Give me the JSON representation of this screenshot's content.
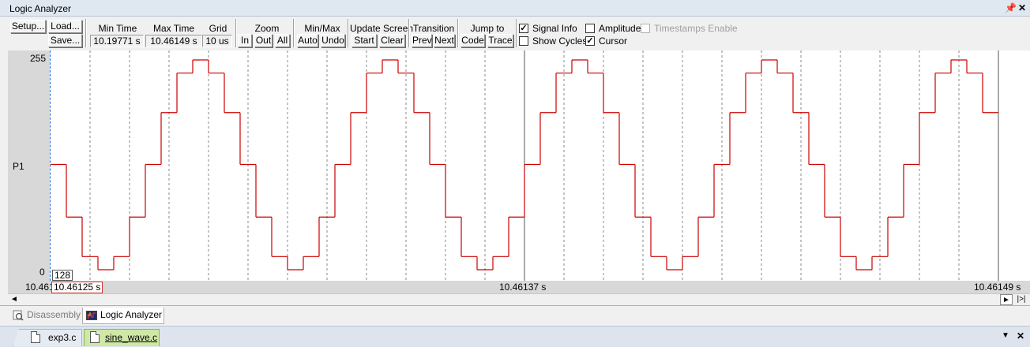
{
  "window": {
    "title": "Logic Analyzer",
    "pin_icon": "pin-icon",
    "close_icon": "close-icon"
  },
  "toolbar": {
    "setup_label": "Setup...",
    "load_label": "Load...",
    "save_label": "Save...",
    "min_time": {
      "title": "Min Time",
      "value": "10.19771 s"
    },
    "max_time": {
      "title": "Max Time",
      "value": "10.46149 s"
    },
    "grid": {
      "title": "Grid",
      "value": "10 us"
    },
    "zoom": {
      "title": "Zoom",
      "in": "In",
      "out": "Out",
      "all": "All"
    },
    "minmax": {
      "title": "Min/Max",
      "auto": "Auto",
      "undo": "Undo"
    },
    "update_screen": {
      "title": "Update Screen",
      "start": "Start",
      "clear": "Clear"
    },
    "transition": {
      "title": "Transition",
      "prev": "Prev",
      "next": "Next"
    },
    "jump_to": {
      "title": "Jump to",
      "code": "Code",
      "trace": "Trace"
    },
    "options": {
      "signal_info": {
        "label": "Signal Info",
        "checked": true
      },
      "show_cycles": {
        "label": "Show Cycles",
        "checked": false
      },
      "amplitude": {
        "label": "Amplitude",
        "checked": false
      },
      "cursor": {
        "label": "Cursor",
        "checked": true
      },
      "timestamps": {
        "label": "Timestamps Enable",
        "checked": false,
        "disabled": true
      }
    }
  },
  "signal": {
    "name": "P1",
    "max_label": "255",
    "min_label": "0",
    "cursor_value": "128",
    "color": "#cc0000"
  },
  "time_axis": {
    "left_value": "10.461",
    "cursor_time": "10.46125 s",
    "mid_time": "10.46137 s",
    "right_time": "10.46149 s"
  },
  "chart_data": {
    "type": "line",
    "series_style": "step",
    "ylim": [
      0,
      255
    ],
    "ytick_labels": [
      "255",
      "0"
    ],
    "xlabel_ticks": [
      "10.461",
      "10.46125 s",
      "10.46137 s",
      "10.46149 s"
    ],
    "grid": "vertical dashed",
    "sample_step_divisions": 0.4,
    "series": [
      {
        "name": "P1",
        "values": [
          128,
          64,
          16,
          0,
          16,
          64,
          128,
          191,
          239,
          255,
          239,
          191,
          128,
          64,
          16,
          0,
          16,
          64,
          128,
          191,
          239,
          255,
          239,
          191,
          128,
          64,
          16,
          0,
          16,
          64,
          128,
          191,
          239,
          255,
          239,
          191,
          128,
          64,
          16,
          0,
          16,
          64,
          128,
          191,
          239,
          255,
          239,
          191,
          128,
          64,
          16,
          0,
          16,
          64,
          128,
          191,
          239,
          255,
          239,
          191
        ]
      }
    ]
  },
  "scrollbar": {
    "left_arrow": "◄",
    "right_arrow": "►",
    "end_label": "|>|"
  },
  "panel_tabs": [
    {
      "label": "Disassembly",
      "icon": "disassembly-icon",
      "active": false
    },
    {
      "label": "Logic Analyzer",
      "icon": "logic-analyzer-icon",
      "active": true
    }
  ],
  "file_tabs": [
    {
      "label": "exp3.c",
      "icon": "file-icon",
      "active": false
    },
    {
      "label": "sine_wave.c",
      "icon": "file-icon",
      "active": true
    }
  ],
  "filebar": {
    "dropdown_icon": "▼",
    "close_icon": "✕"
  }
}
